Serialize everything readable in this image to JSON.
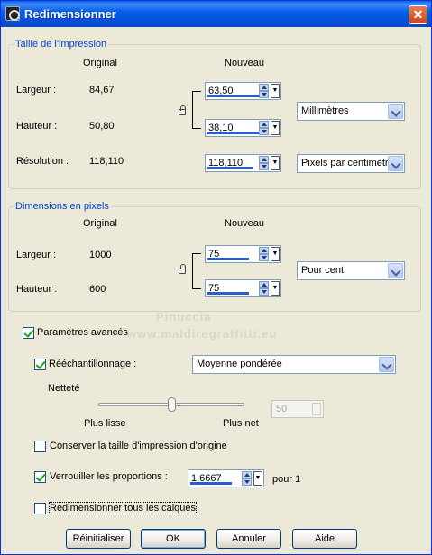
{
  "window": {
    "title": "Redimensionner",
    "close_label": "✕"
  },
  "print_size": {
    "group_title": "Taille de l'impression",
    "col_original": "Original",
    "col_new": "Nouveau",
    "width_label": "Largeur :",
    "width_original": "84,67",
    "width_new": "63,50",
    "height_label": "Hauteur :",
    "height_original": "50,80",
    "height_new": "38,10",
    "unit": "Millimètres",
    "resolution_label": "Résolution :",
    "resolution_original": "118,110",
    "resolution_new": "118,110",
    "resolution_unit": "Pixels par centimètre"
  },
  "pixel_size": {
    "group_title": "Dimensions en pixels",
    "col_original": "Original",
    "col_new": "Nouveau",
    "width_label": "Largeur :",
    "width_original": "1000",
    "width_new": "75",
    "height_label": "Hauteur :",
    "height_original": "600",
    "height_new": "75",
    "unit": "Pour cent"
  },
  "watermark": {
    "line1": "Pinuccia",
    "line2": "www.maldiregraffitti.eu"
  },
  "advanced": {
    "label": "Paramètres avancés",
    "checked": true,
    "resample_label": "Rééchantillonnage :",
    "resample_checked": true,
    "resample_method": "Moyenne pondérée",
    "sharpness_label": "Netteté",
    "sharpness_value": "50",
    "sharpness_level": 0.5,
    "slider_left_label": "Plus lisse",
    "slider_right_label": "Plus net",
    "keep_print_label": "Conserver la taille d'impression d'origine",
    "keep_print_checked": false,
    "lock_ratio_label": "Verrouiller les proportions :",
    "lock_ratio_checked": true,
    "ratio_value": "1,6667",
    "ratio_suffix": "pour 1",
    "resize_all_label": "Redimensionner tous les calques",
    "resize_all_checked": false
  },
  "buttons": {
    "reset": "Réinitialiser",
    "ok": "OK",
    "cancel": "Annuler",
    "help": "Aide"
  }
}
